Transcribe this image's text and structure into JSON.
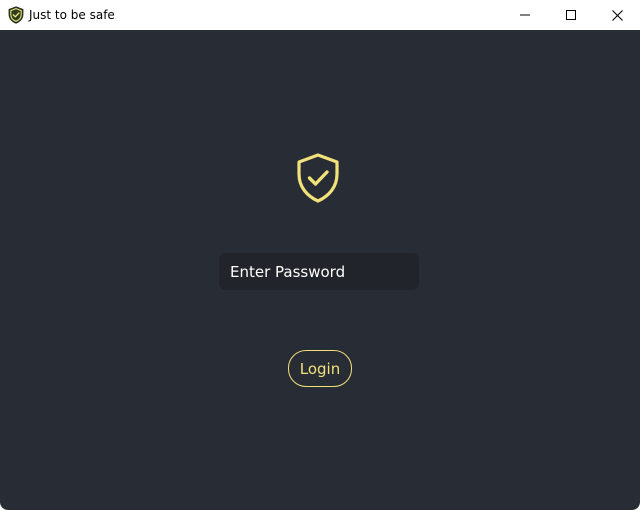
{
  "window": {
    "title": "Just to be safe",
    "controls": {
      "minimize_icon": "minimize-icon",
      "maximize_icon": "maximize-icon",
      "close_icon": "close-icon"
    }
  },
  "login": {
    "logo_icon": "shield-check-icon",
    "password_placeholder": "Enter Password",
    "password_value": "",
    "login_label": "Login"
  },
  "colors": {
    "background": "#282c34",
    "input_background": "#21242b",
    "accent": "#f2e27a",
    "text": "#ffffff"
  }
}
